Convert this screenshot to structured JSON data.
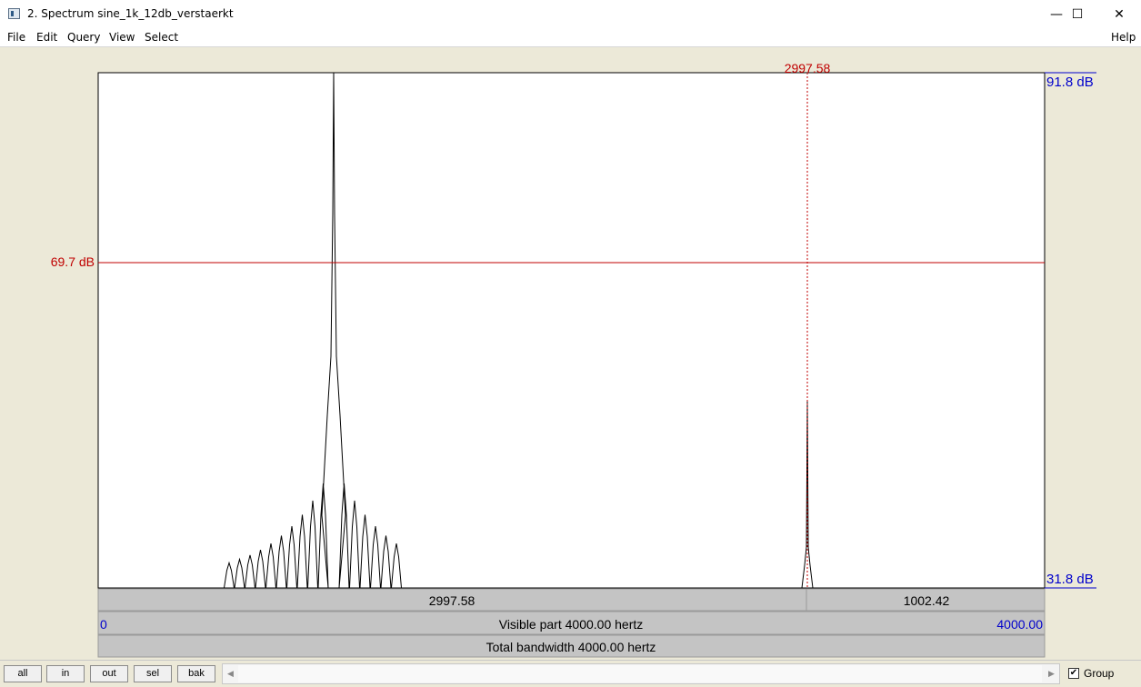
{
  "window": {
    "title": "2. Spectrum sine_1k_12db_verstaerkt",
    "minimize": "—",
    "maximize": "☐",
    "close": "✕"
  },
  "menu": {
    "file": "File",
    "edit": "Edit",
    "query": "Query",
    "view": "View",
    "select": "Select",
    "help": "Help"
  },
  "spectrum": {
    "cursor_freq_label": "2997.58",
    "cursor_db_label": "69.7 dB",
    "top_db_label": "91.8 dB",
    "bottom_db_label": "31.8 dB",
    "left_of_cursor": "2997.58",
    "right_of_cursor": "1002.42",
    "visible_min": "0",
    "visible_label": "Visible part 4000.00 hertz",
    "visible_max": "4000.00",
    "total_label": "Total bandwidth 4000.00 hertz",
    "colors": {
      "cursor": "#c00000",
      "axis": "#0000cc",
      "curve": "#000000"
    }
  },
  "toolbar": {
    "all": "all",
    "in": "in",
    "out": "out",
    "sel": "sel",
    "bak": "bak",
    "scroll_left": "◀",
    "scroll_right": "▶",
    "group_label": "Group",
    "group_checked": true,
    "group_check_glyph": "✔"
  }
}
